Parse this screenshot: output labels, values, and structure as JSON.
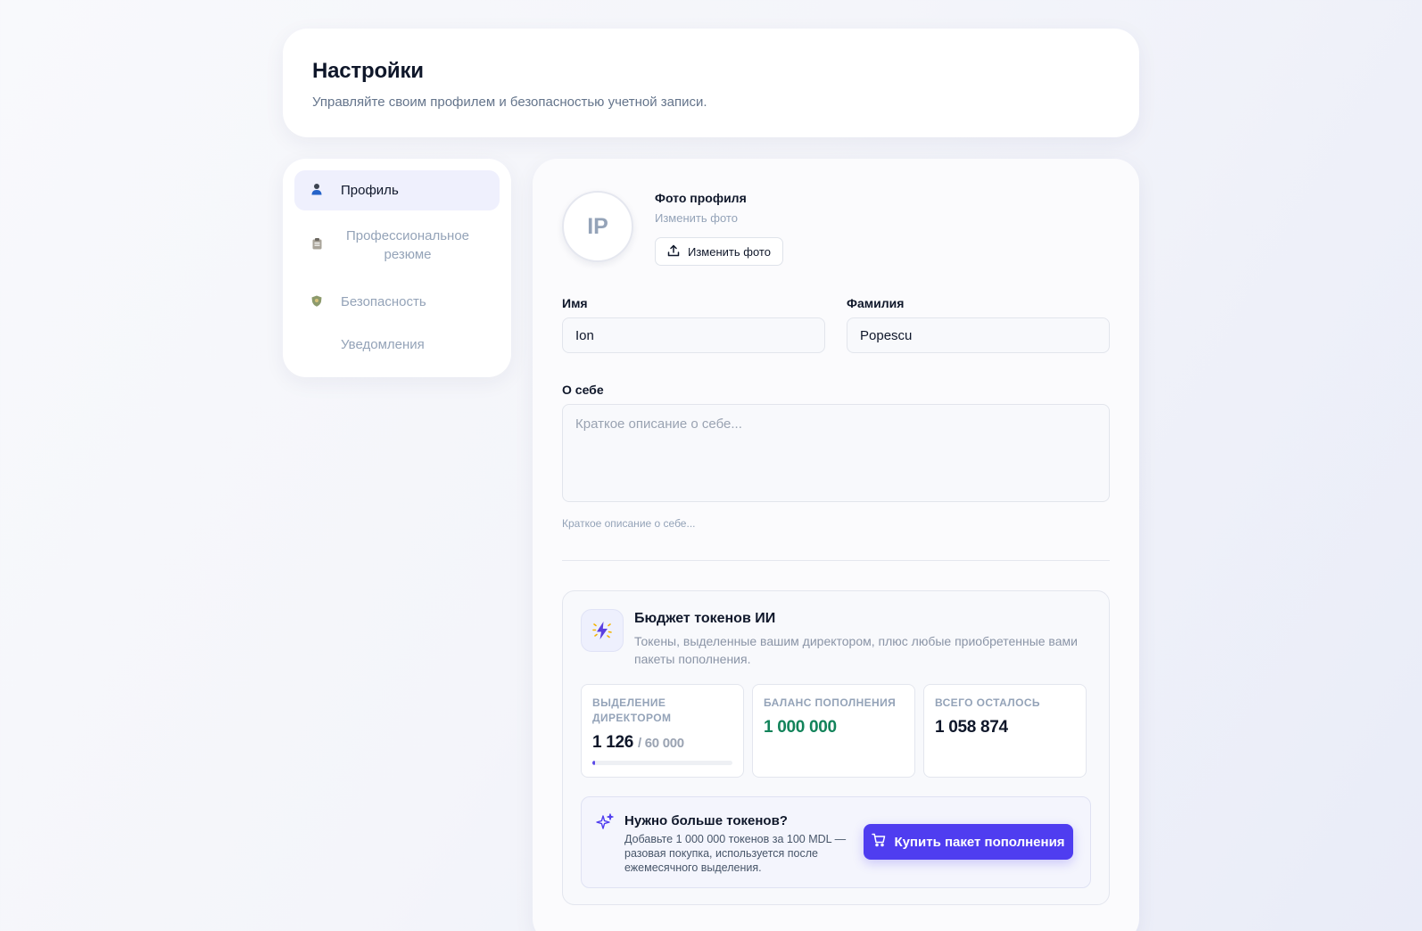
{
  "header": {
    "title": "Настройки",
    "subtitle": "Управляйте своим профилем и безопасностью учетной записи."
  },
  "nav": {
    "items": [
      {
        "label": "Профиль",
        "icon": "person-icon"
      },
      {
        "label": "Профессиональное резюме",
        "icon": "clipboard-icon"
      },
      {
        "label": "Безопасность",
        "icon": "shield-icon"
      },
      {
        "label": "Уведомления",
        "icon": ""
      }
    ],
    "active_index": 0
  },
  "profile": {
    "avatar_initials": "IP",
    "photo_title": "Фото профиля",
    "photo_subtitle": "Изменить фото",
    "photo_button": "Изменить фото",
    "first_name_label": "Имя",
    "first_name_value": "Ion",
    "last_name_label": "Фамилия",
    "last_name_value": "Popescu",
    "about_label": "О себе",
    "about_placeholder": "Краткое описание о себе...",
    "about_hint": "Краткое описание о себе..."
  },
  "tokens": {
    "title": "Бюджет токенов ИИ",
    "description": "Токены, выделенные вашим директором, плюс любые приобретенные вами пакеты пополнения.",
    "director": {
      "label": "Выделение директором",
      "used": "1 126",
      "total": "/ 60 000",
      "fraction": 0.019
    },
    "topup": {
      "label": "Баланс пополнения",
      "value": "1 000 000"
    },
    "remaining": {
      "label": "Всего осталось",
      "value": "1 058 874"
    },
    "cta_title": "Нужно больше токенов?",
    "cta_desc": "Добавьте 1 000 000 токенов за 100 MDL — разовая покупка, используется после ежемесячного выделения.",
    "cta_button": "Купить пакет пополнения"
  },
  "colors": {
    "accent": "#4f3df0",
    "success": "#12835a"
  }
}
